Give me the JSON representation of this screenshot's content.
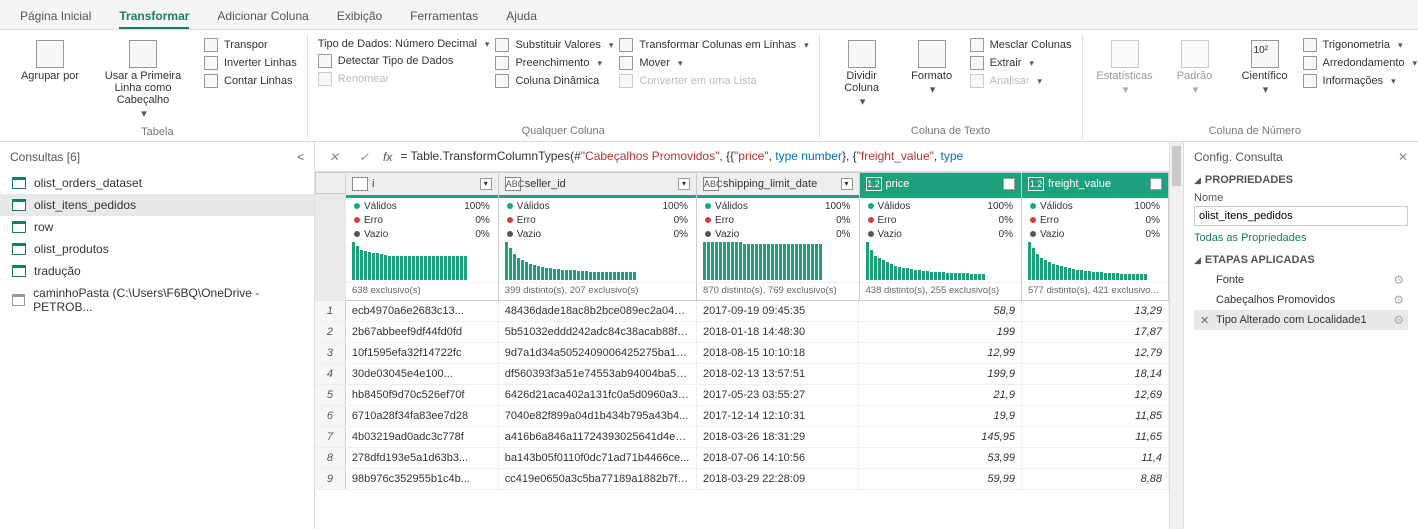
{
  "tabs": {
    "items": [
      "Página Inicial",
      "Transformar",
      "Adicionar Coluna",
      "Exibição",
      "Ferramentas",
      "Ajuda"
    ],
    "active": 1
  },
  "ribbon": {
    "groups": {
      "tabela": {
        "label": "Tabela",
        "agrupar": "Agrupar por",
        "usar_primeira": "Usar a Primeira Linha como Cabeçalho",
        "transpor": "Transpor",
        "inverter": "Inverter Linhas",
        "contar": "Contar Linhas"
      },
      "qualquer": {
        "label": "Qualquer Coluna",
        "tipo_dados": "Tipo de Dados: Número Decimal",
        "detectar": "Detectar Tipo de Dados",
        "renomear": "Renomear",
        "substituir": "Substituir Valores",
        "preench": "Preenchimento",
        "dinamica": "Coluna Dinâmica",
        "transformar_linhas": "Transformar Colunas em Linhas",
        "mover": "Mover",
        "converter": "Converter em uma Lista"
      },
      "texto": {
        "label": "Coluna de Texto",
        "dividir": "Dividir Coluna",
        "formato": "Formato",
        "mesclar": "Mesclar Colunas",
        "extrair": "Extrair",
        "analisar": "Analisar"
      },
      "numero": {
        "label": "Coluna de Número",
        "estat": "Estatísticas",
        "padrao": "Padrão",
        "cient": "Científico",
        "trig": "Trigonometria",
        "arred": "Arredondamento",
        "info": "Informações"
      }
    }
  },
  "queries": {
    "title": "Consultas [6]",
    "items": [
      {
        "name": "olist_orders_dataset",
        "type": "table"
      },
      {
        "name": "olist_itens_pedidos",
        "type": "table",
        "selected": true
      },
      {
        "name": "row",
        "type": "table"
      },
      {
        "name": "olist_produtos",
        "type": "table"
      },
      {
        "name": "tradução",
        "type": "table"
      },
      {
        "name": "caminhoPasta (C:\\Users\\F6BQ\\OneDrive - PETROB...",
        "type": "file"
      }
    ]
  },
  "formula": {
    "prefix": "= Table.TransformColumnTypes(#",
    "s1": "\"Cabeçalhos Promovidos\"",
    "mid1": ", {{",
    "s2": "\"price\"",
    "mid2": ", ",
    "kw1": "type number",
    "mid3": "}, {",
    "s3": "\"freight_value\"",
    "mid4": ", ",
    "kw2": "type"
  },
  "columns": [
    {
      "name": "i",
      "typeLabel": "",
      "kind": "text",
      "valid": "100%",
      "err": "0%",
      "empty": "0%",
      "distinct": "638 exclusivo(s)"
    },
    {
      "name": "seller_id",
      "typeLabel": "ABC",
      "kind": "text",
      "valid": "100%",
      "err": "0%",
      "empty": "0%",
      "distinct": "399 distinto(s), 207 exclusivo(s)"
    },
    {
      "name": "shipping_limit_date",
      "typeLabel": "ABC",
      "kind": "text",
      "valid": "100%",
      "err": "0%",
      "empty": "0%",
      "distinct": "870 distinto(s), 769 exclusivo(s)"
    },
    {
      "name": "price",
      "typeLabel": "1.2",
      "kind": "num",
      "valid": "100%",
      "err": "0%",
      "empty": "0%",
      "distinct": "438 distinto(s), 255 exclusivo(s)"
    },
    {
      "name": "freight_value",
      "typeLabel": "1.2",
      "kind": "num",
      "valid": "100%",
      "err": "0%",
      "empty": "0%",
      "distinct": "577 distinto(s), 421 exclusivo..."
    }
  ],
  "stats_labels": {
    "valid": "Válidos",
    "err": "Erro",
    "empty": "Vazio"
  },
  "rows": [
    {
      "n": 1,
      "c": [
        "ecb4970a6e2683c13...",
        "48436dade18ac8b2bce089ec2a0412...",
        "2017-09-19 09:45:35",
        "58,9",
        "13,29"
      ]
    },
    {
      "n": 2,
      "c": [
        "2b67abbeef9df44fd0fd",
        "5b51032eddd242adc84c38acab88f2...",
        "2018-01-18 14:48:30",
        "199",
        "17,87"
      ]
    },
    {
      "n": 3,
      "c": [
        "10f1595efa32f14722fc",
        "9d7a1d34a5052409006425275ba1c...",
        "2018-08-15 10:10:18",
        "12,99",
        "12,79"
      ]
    },
    {
      "n": 4,
      "c": [
        "30de03045e4e100...",
        "df560393f3a51e74553ab94004ba5c...",
        "2018-02-13 13:57:51",
        "199,9",
        "18,14"
      ]
    },
    {
      "n": 5,
      "c": [
        "hb8450f9d70c526ef70f",
        "6426d21aca402a131fc0a5d0960a3c90",
        "2017-05-23 03:55:27",
        "21,9",
        "12,69"
      ]
    },
    {
      "n": 6,
      "c": [
        "6710a28f34fa83ee7d28",
        "7040e82f899a04d1b434b795a43b4...",
        "2017-12-14 12:10:31",
        "19,9",
        "11,85"
      ]
    },
    {
      "n": 7,
      "c": [
        "4b03219ad0adc3c778f",
        "a416b6a846a11724393025641d4ed...",
        "2018-03-26 18:31:29",
        "145,95",
        "11,65"
      ]
    },
    {
      "n": 8,
      "c": [
        "278dfd193e5a1d63b3...",
        "ba143b05f0110f0dc71ad71b4466ce...",
        "2018-07-06 14:10:56",
        "53,99",
        "11,4"
      ]
    },
    {
      "n": 9,
      "c": [
        "98b976c352955b1c4b...",
        "cc419e0650a3c5ba77189a1882b7f5...",
        "2018-03-29 22:28:09",
        "59,99",
        "8,88"
      ]
    }
  ],
  "rpanel": {
    "title": "Config. Consulta",
    "props": "PROPRIEDADES",
    "name_label": "Nome",
    "name_value": "olist_itens_pedidos",
    "all_props": "Todas as Propriedades",
    "steps_title": "ETAPAS APLICADAS",
    "steps": [
      {
        "label": "Fonte",
        "gear": true
      },
      {
        "label": "Cabeçalhos Promovidos",
        "gear": true
      },
      {
        "label": "Tipo Alterado com Localidade1",
        "gear": true,
        "selected": true,
        "x": true
      }
    ]
  },
  "spark_heights": [
    [
      38,
      34,
      30,
      29,
      28,
      27,
      27,
      26,
      25,
      24,
      24,
      24,
      24,
      24,
      24,
      24,
      24,
      24,
      24,
      24,
      24,
      24,
      24,
      24,
      24,
      24,
      24,
      24,
      24
    ],
    [
      38,
      32,
      26,
      22,
      20,
      18,
      16,
      15,
      14,
      13,
      12,
      12,
      11,
      11,
      10,
      10,
      10,
      10,
      9,
      9,
      9,
      8,
      8,
      8,
      8,
      8,
      8,
      8,
      8,
      8,
      8,
      8,
      8
    ],
    [
      38,
      38,
      38,
      38,
      38,
      38,
      38,
      38,
      38,
      38,
      36,
      36,
      36,
      36,
      36,
      36,
      36,
      36,
      36,
      36,
      36,
      36,
      36,
      36,
      36,
      36,
      36,
      36,
      36,
      36
    ],
    [
      38,
      30,
      24,
      22,
      20,
      18,
      16,
      14,
      13,
      12,
      12,
      11,
      10,
      10,
      9,
      9,
      8,
      8,
      8,
      8,
      7,
      7,
      7,
      7,
      7,
      7,
      6,
      6,
      6,
      6
    ],
    [
      38,
      32,
      26,
      22,
      20,
      18,
      16,
      15,
      14,
      13,
      12,
      11,
      10,
      10,
      9,
      9,
      8,
      8,
      8,
      7,
      7,
      7,
      7,
      6,
      6,
      6,
      6,
      6,
      6,
      6
    ]
  ]
}
